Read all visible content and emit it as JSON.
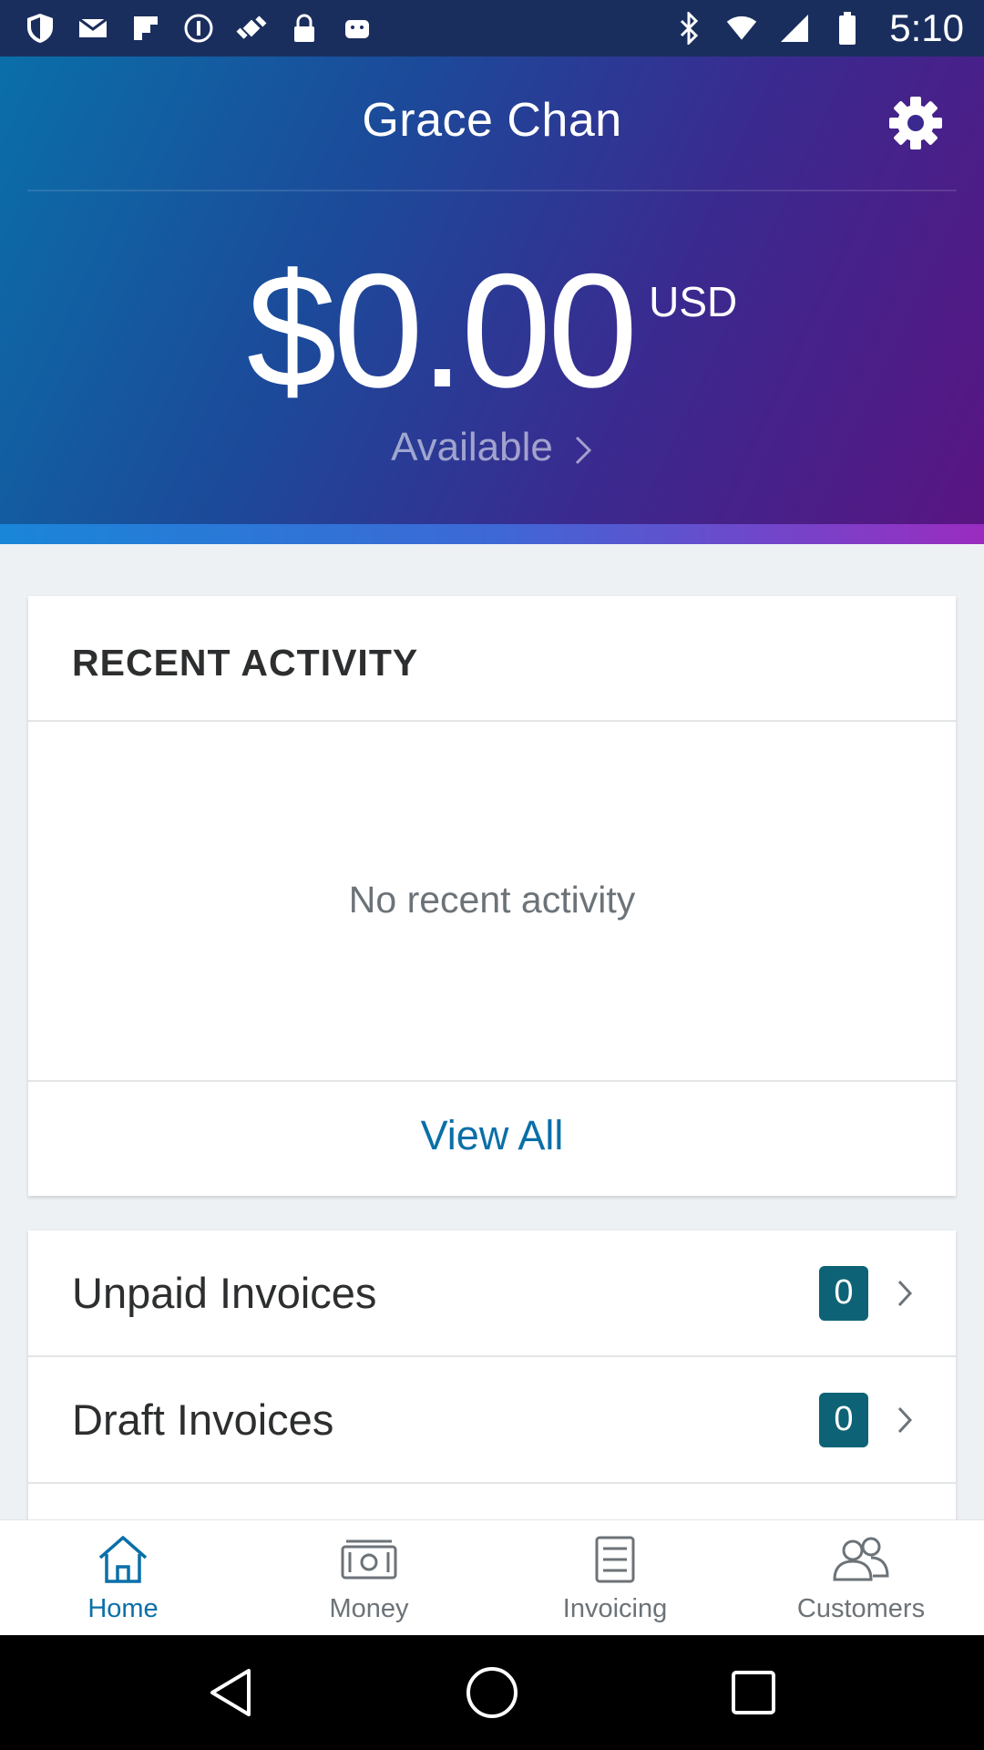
{
  "status_bar": {
    "time": "5:10",
    "icons_left": [
      "shield-icon",
      "mail-icon",
      "flipboard-icon",
      "info-icon",
      "fake-gps-icon",
      "lock-icon",
      "android-icon"
    ],
    "icons_right": [
      "bluetooth-icon",
      "wifi-icon",
      "signal-icon",
      "battery-icon"
    ]
  },
  "header": {
    "user_name": "Grace Chan",
    "balance": "$0.00",
    "currency": "USD",
    "available_label": "Available",
    "settings_icon": "gear-icon"
  },
  "activity": {
    "title": "RECENT ACTIVITY",
    "empty_text": "No recent activity",
    "view_all_label": "View All"
  },
  "invoices": [
    {
      "label": "Unpaid Invoices",
      "count": "0"
    },
    {
      "label": "Draft Invoices",
      "count": "0"
    }
  ],
  "tabs": [
    {
      "label": "Home",
      "icon": "home-icon",
      "active": true
    },
    {
      "label": "Money",
      "icon": "money-icon",
      "active": false
    },
    {
      "label": "Invoicing",
      "icon": "invoice-icon",
      "active": false
    },
    {
      "label": "Customers",
      "icon": "customers-icon",
      "active": false
    }
  ],
  "colors": {
    "accent": "#0a6fa8",
    "badge": "#0d6375",
    "header_start": "#0a6fa8",
    "header_end": "#5a1482"
  }
}
